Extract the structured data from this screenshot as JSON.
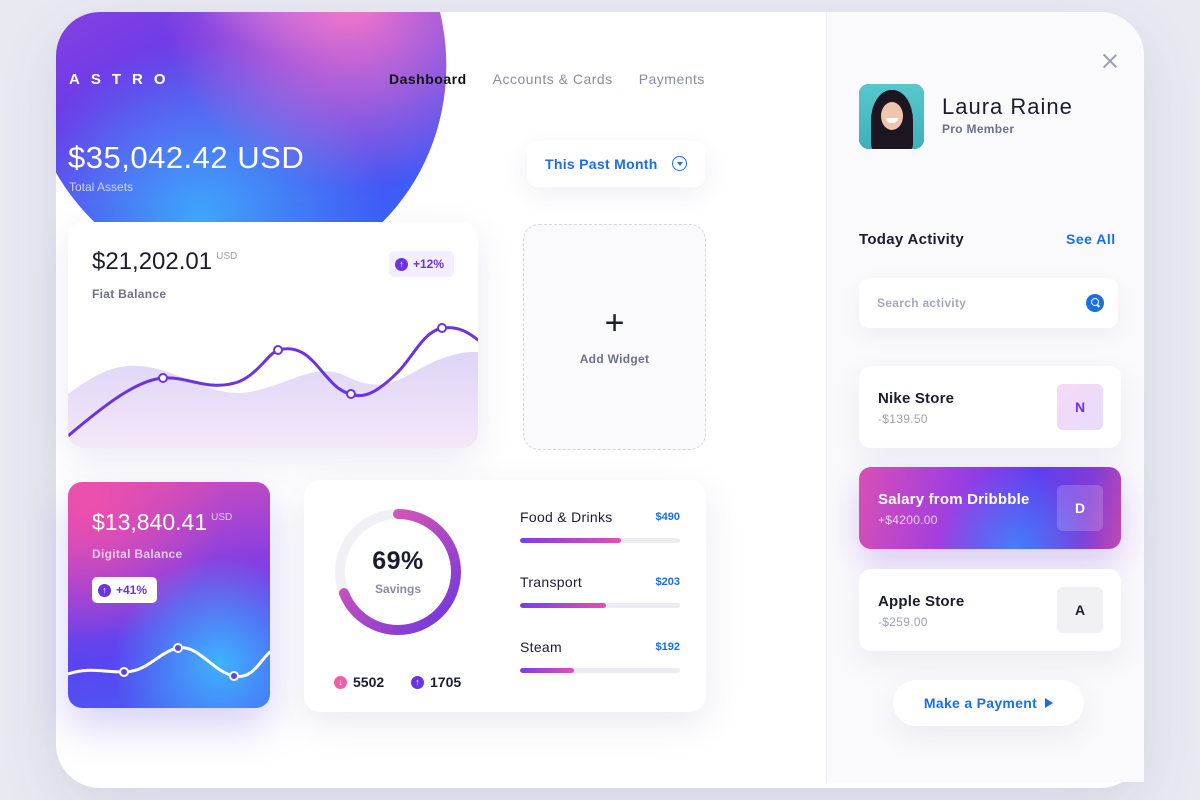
{
  "brand": {
    "name": "ASTRO"
  },
  "header": {
    "total_amount": "$35,042.42 USD",
    "total_label": "Total Assets"
  },
  "nav": [
    {
      "label": "Dashboard",
      "active": true
    },
    {
      "label": "Accounts & Cards",
      "active": false
    },
    {
      "label": "Payments",
      "active": false
    }
  ],
  "period_selector": {
    "label": "This Past Month",
    "icon": "chevron-down-circle-icon"
  },
  "fiat_card": {
    "amount": "$21,202.01",
    "currency": "USD",
    "label": "Fiat Balance",
    "change": "+12%",
    "change_icon": "arrow-up-icon"
  },
  "add_widget": {
    "icon": "plus-icon",
    "label": "Add Widget"
  },
  "digital_card": {
    "amount": "$13,840.41",
    "currency": "USD",
    "label": "Digital Balance",
    "change": "+41%",
    "change_icon": "arrow-up-icon"
  },
  "savings_card": {
    "percent": "69%",
    "label": "Savings",
    "percent_value": 0.69,
    "stats": [
      {
        "value": "5502",
        "icon": "arrow-down-icon",
        "color": "#f45ea8"
      },
      {
        "value": "1705",
        "icon": "arrow-up-icon",
        "color": "#6a35e0"
      }
    ],
    "categories": [
      {
        "name": "Food & Drinks",
        "amount": "$490",
        "progress": 0.63
      },
      {
        "name": "Transport",
        "amount": "$203",
        "progress": 0.54
      },
      {
        "name": "Steam",
        "amount": "$192",
        "progress": 0.34
      }
    ]
  },
  "profile": {
    "name": "Laura Raine",
    "membership": "Pro Member"
  },
  "activity": {
    "title": "Today Activity",
    "see_all": "See All",
    "search_placeholder": "Search activity",
    "items": [
      {
        "name": "Nike Store",
        "amount": "-$139.50",
        "initial": "N"
      },
      {
        "name": "Salary from Dribbble",
        "amount": "+$4200.00",
        "initial": "D"
      },
      {
        "name": "Apple Store",
        "amount": "-$259.00",
        "initial": "A"
      }
    ]
  },
  "payment_button": {
    "label": "Make a Payment",
    "icon": "play-arrow-icon"
  },
  "colors": {
    "accent": "#1a6fe6",
    "purple": "#6a35e0",
    "pink": "#f45ea8"
  }
}
